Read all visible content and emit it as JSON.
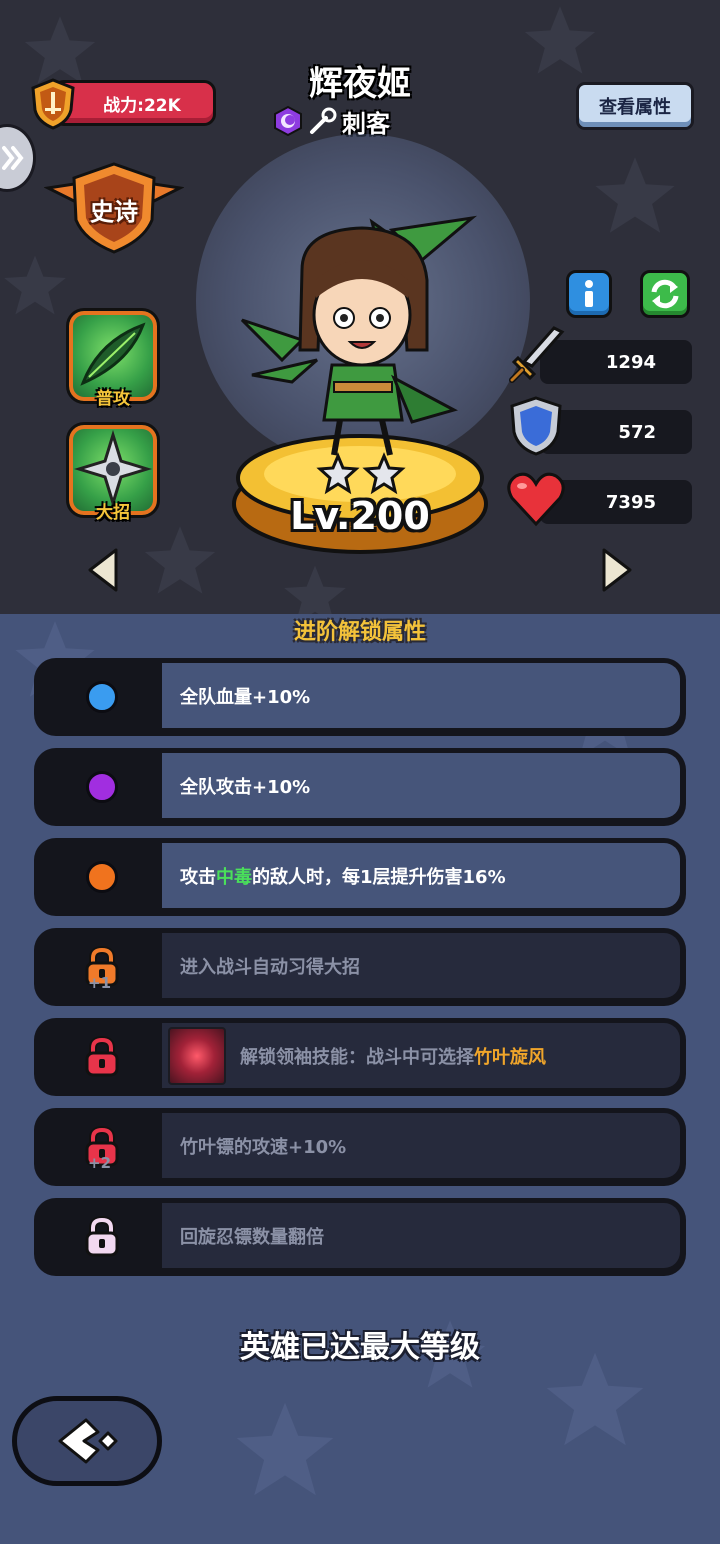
{
  "header": {
    "power_label": "战力:22K",
    "hero_name": "辉夜姬",
    "hero_class": "刺客",
    "view_attributes_label": "查看属性"
  },
  "rarity": {
    "label": "史诗",
    "color": "#e8792a"
  },
  "skills": [
    {
      "label": "普攻",
      "icon": "leaf-blade-icon"
    },
    {
      "label": "大招",
      "icon": "shuriken-icon"
    }
  ],
  "hero": {
    "level": "Lv.200",
    "stars": 2,
    "stats": {
      "attack": "1294",
      "defense": "572",
      "hp": "7395"
    }
  },
  "advancement": {
    "title": "进阶解锁属性",
    "rows": [
      {
        "dot_color": "#3a9cf0",
        "text": "全队血量+10%",
        "locked": false
      },
      {
        "dot_color": "#a12ee0",
        "text": "全队攻击+10%",
        "locked": false
      },
      {
        "dot_color": "#f0731e",
        "text_pre": "攻击",
        "text_highlight": "中毒",
        "text_post": "的敌人时，每1层提升伤害16%",
        "locked": false
      },
      {
        "lock_color": "#f07a2a",
        "lock_badge": "+1",
        "text": "进入战斗自动习得大招",
        "locked": true
      },
      {
        "lock_color": "#e8344a",
        "text_pre": "解锁领袖技能：战斗中可选择",
        "text_highlight": "竹叶旋风",
        "locked": true
      },
      {
        "lock_color": "#e8344a",
        "lock_badge": "+2",
        "text": "竹叶镖的攻速+10%",
        "locked": true
      },
      {
        "lock_color": "#f2d8f0",
        "text": "回旋忍镖数量翻倍",
        "locked": true
      }
    ]
  },
  "footer": {
    "max_level_text": "英雄已达最大等级"
  }
}
